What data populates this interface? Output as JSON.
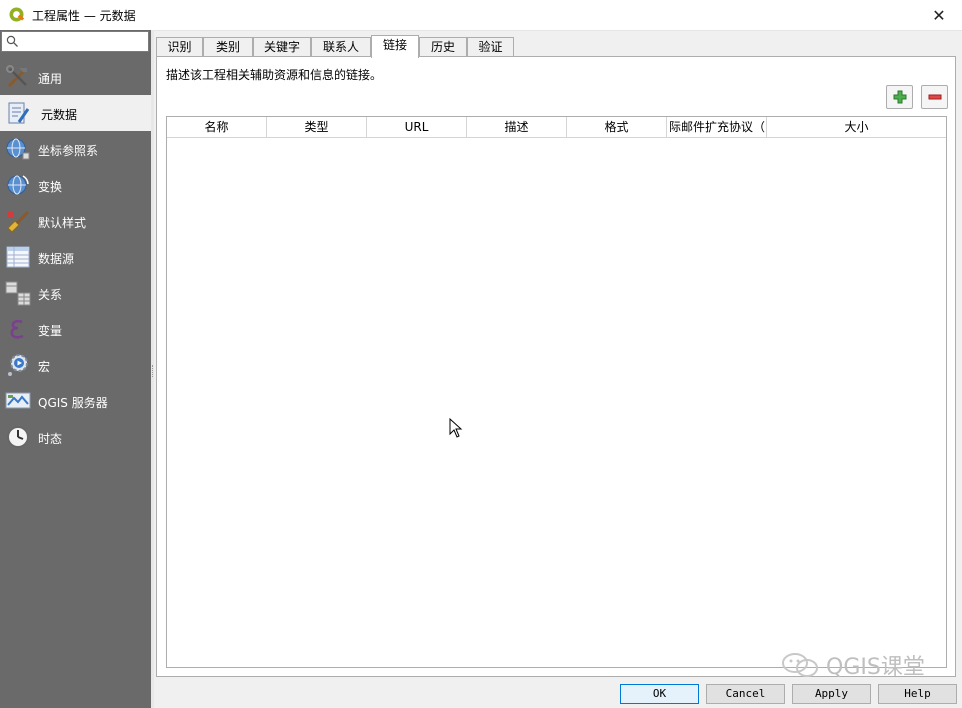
{
  "window": {
    "title": "工程属性 — 元数据",
    "close_label": "✕"
  },
  "search": {
    "value": "",
    "placeholder": ""
  },
  "sidebar": {
    "items": [
      {
        "label": "通用",
        "icon": "tools-icon"
      },
      {
        "label": "元数据",
        "icon": "metadata-edit-icon"
      },
      {
        "label": "坐标参照系",
        "icon": "globe-crs-icon"
      },
      {
        "label": "变换",
        "icon": "globe-transform-icon"
      },
      {
        "label": "默认样式",
        "icon": "paint-brush-icon"
      },
      {
        "label": "数据源",
        "icon": "table-icon"
      },
      {
        "label": "关系",
        "icon": "relations-icon"
      },
      {
        "label": "变量",
        "icon": "epsilon-icon"
      },
      {
        "label": "宏",
        "icon": "gear-play-icon"
      },
      {
        "label": "QGIS 服务器",
        "icon": "map-server-icon"
      },
      {
        "label": "时态",
        "icon": "clock-icon"
      }
    ],
    "active_index": 1
  },
  "tabs": [
    "识别",
    "类别",
    "关键字",
    "联系人",
    "链接",
    "历史",
    "验证"
  ],
  "active_tab": 4,
  "links_panel": {
    "description": "描述该工程相关辅助资源和信息的链接。",
    "add_button": "plus-icon",
    "remove_button": "minus-icon",
    "columns": [
      "名称",
      "类型",
      "URL",
      "描述",
      "格式",
      "际邮件扩充协议（",
      "大小"
    ],
    "rows": []
  },
  "watermark": {
    "text": "QGIS课堂"
  },
  "footer": {
    "ok": "OK",
    "cancel": "Cancel",
    "apply": "Apply",
    "help": "Help"
  },
  "colors": {
    "sidebar_bg": "#6a6a6a",
    "add_green": "#3a9a3a",
    "remove_red": "#d03030",
    "primary_border": "#0078d7"
  }
}
